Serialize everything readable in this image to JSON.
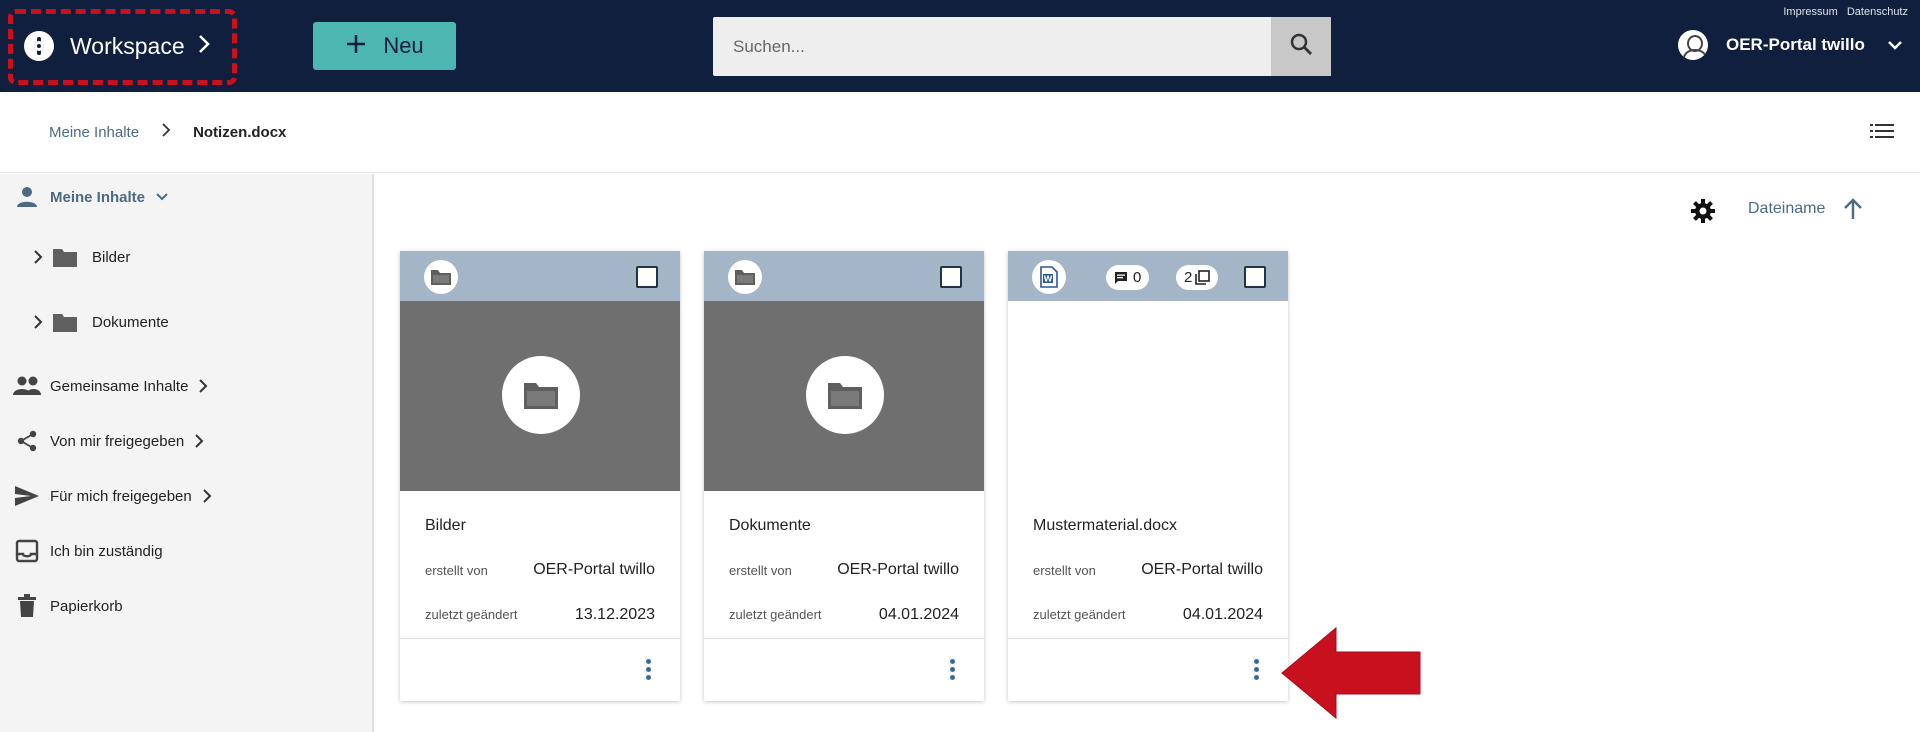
{
  "header": {
    "legal_links": [
      "Impressum",
      "Datenschutz"
    ],
    "workspace_label": "Workspace",
    "new_button_label": "Neu",
    "search_placeholder": "Suchen...",
    "user_name": "OER-Portal twillo"
  },
  "breadcrumb": {
    "items": [
      "Meine Inhalte",
      "Notizen.docx"
    ]
  },
  "sidebar": {
    "items": [
      {
        "label": "Meine Inhalte",
        "icon": "person-icon",
        "active": true
      },
      {
        "label": "Gemeinsame Inhalte",
        "icon": "people-icon"
      },
      {
        "label": "Von mir freigegeben",
        "icon": "share-icon"
      },
      {
        "label": "Für mich freigegeben",
        "icon": "send-icon"
      },
      {
        "label": "Ich bin zuständig",
        "icon": "inbox-icon"
      },
      {
        "label": "Papierkorb",
        "icon": "trash-icon"
      }
    ],
    "subfolders": [
      "Bilder",
      "Dokumente"
    ]
  },
  "sort": {
    "label": "Dateiname"
  },
  "cards": [
    {
      "title": "Bilder",
      "created_label": "erstellt von",
      "created_by": "OER-Portal twillo",
      "modified_label": "zuletzt geändert",
      "modified": "13.12.2023",
      "type_icon": "folder-icon"
    },
    {
      "title": "Dokumente",
      "created_label": "erstellt von",
      "created_by": "OER-Portal twillo",
      "modified_label": "zuletzt geändert",
      "modified": "04.01.2024",
      "type_icon": "folder-icon"
    },
    {
      "title": "Mustermaterial.docx",
      "created_label": "erstellt von",
      "created_by": "OER-Portal twillo",
      "modified_label": "zuletzt geändert",
      "modified": "04.01.2024",
      "type_icon": "word-doc-icon",
      "comments": "0",
      "versions": "2"
    }
  ],
  "colors": {
    "header_bg": "#0f1f3d",
    "accent_teal": "#4db6b1",
    "card_header": "#a3b5c6",
    "highlight_red": "#c8101e",
    "link_blue": "#4c6a86"
  }
}
